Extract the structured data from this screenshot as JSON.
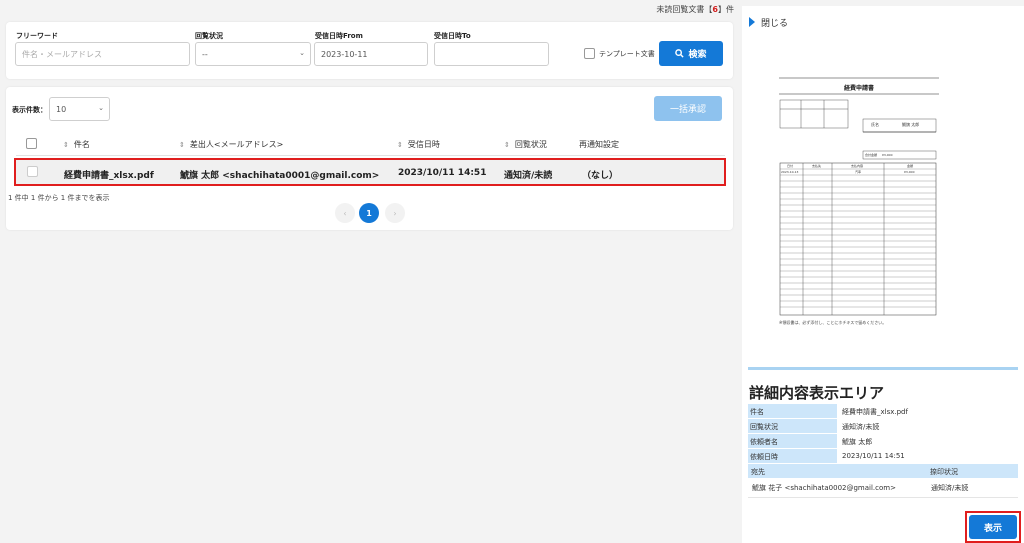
{
  "header": {
    "unread_prefix": "未読回覧文書【",
    "unread_count": "6",
    "unread_suffix": "】件"
  },
  "search": {
    "freeword_label": "フリーワード",
    "freeword_placeholder": "件名・メールアドレス",
    "status_label": "回覧状況",
    "status_value": "--",
    "from_label": "受信日時From",
    "from_value": "2023-10-11",
    "to_label": "受信日時To",
    "to_value": "",
    "template_label": "テンプレート文書",
    "search_button": "検索"
  },
  "list": {
    "page_size_label": "表示件数：",
    "page_size_value": "10",
    "bulk_button": "一括承認",
    "columns": [
      "件名",
      "差出人<メールアドレス>",
      "受信日時",
      "回覧状況",
      "再通知設定"
    ],
    "rows": [
      {
        "subject": "経費申請書_xlsx.pdf",
        "sender": "鯱旗 太郎 <shachihata0001@gmail.com>",
        "received": "2023/10/11 14:51",
        "status": "通知済/未読",
        "renotify": "（なし）"
      }
    ],
    "pager_info": "1 件中 1 件から 1 件までを表示",
    "current_page": "1",
    "prev": "‹",
    "next": "›"
  },
  "side": {
    "close_label": "閉じる",
    "preview": {
      "title": "経費申請書",
      "name_label": "氏名",
      "name_value": "鯱旗 太郎",
      "total_label": "合計金額",
      "total_value": "¥3,000",
      "table_headers": [
        "日付",
        "支払先",
        "支払内容",
        "金額"
      ],
      "first_row": [
        "2023-10-13",
        "",
        "汽車",
        "¥3,000"
      ],
      "note": "※領収書は、必ず添付し、ことにホチキスで留めください。"
    },
    "detail_title": "詳細内容表示エリア",
    "details": [
      {
        "label": "件名",
        "value": "経費申請書_xlsx.pdf"
      },
      {
        "label": "回覧状況",
        "value": "通知済/未読"
      },
      {
        "label": "依頼者名",
        "value": "鯱旗 太郎"
      },
      {
        "label": "依頼日時",
        "value": "2023/10/11 14:51"
      }
    ],
    "recipient_header": "宛先",
    "seal_header": "捺印状況",
    "recipient": "鯱旗 花子 <shachihata0002@gmail.com>",
    "recipient_status": "通知済/未読",
    "show_button": "表示"
  },
  "colors": {
    "primary": "#1479d7",
    "disabled": "#8ec2ee",
    "highlight": "#e01e1e",
    "label_bg": "#cde6fa"
  }
}
